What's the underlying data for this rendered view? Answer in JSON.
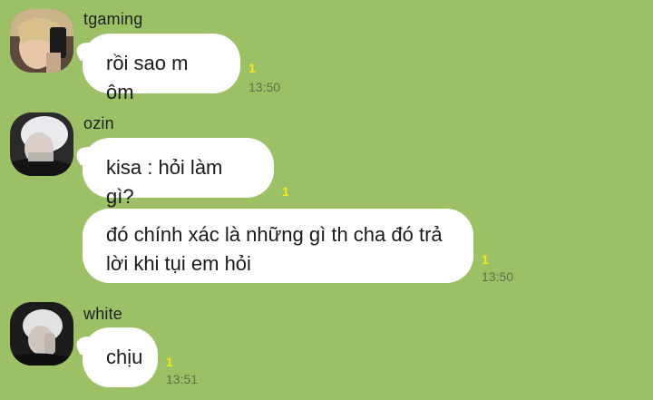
{
  "messages": [
    {
      "sender": "tgaming",
      "bubbles": [
        {
          "text": "rồi sao m ôm",
          "read_count": "1",
          "time": "13:50"
        }
      ]
    },
    {
      "sender": "ozin",
      "bubbles": [
        {
          "text": "kisa : hỏi làm gì?",
          "read_count": "1",
          "time": ""
        },
        {
          "text": "đó chính xác là những gì th cha đó trả lời khi tụi em hỏi",
          "read_count": "1",
          "time": "13:50"
        }
      ]
    },
    {
      "sender": "white",
      "bubbles": [
        {
          "text": "chịu",
          "read_count": "1",
          "time": "13:51"
        }
      ]
    }
  ],
  "colors": {
    "background": "#9bc065",
    "bubble": "#ffffff",
    "read_indicator": "#f6e91a",
    "timestamp": "#5e6e4a"
  }
}
